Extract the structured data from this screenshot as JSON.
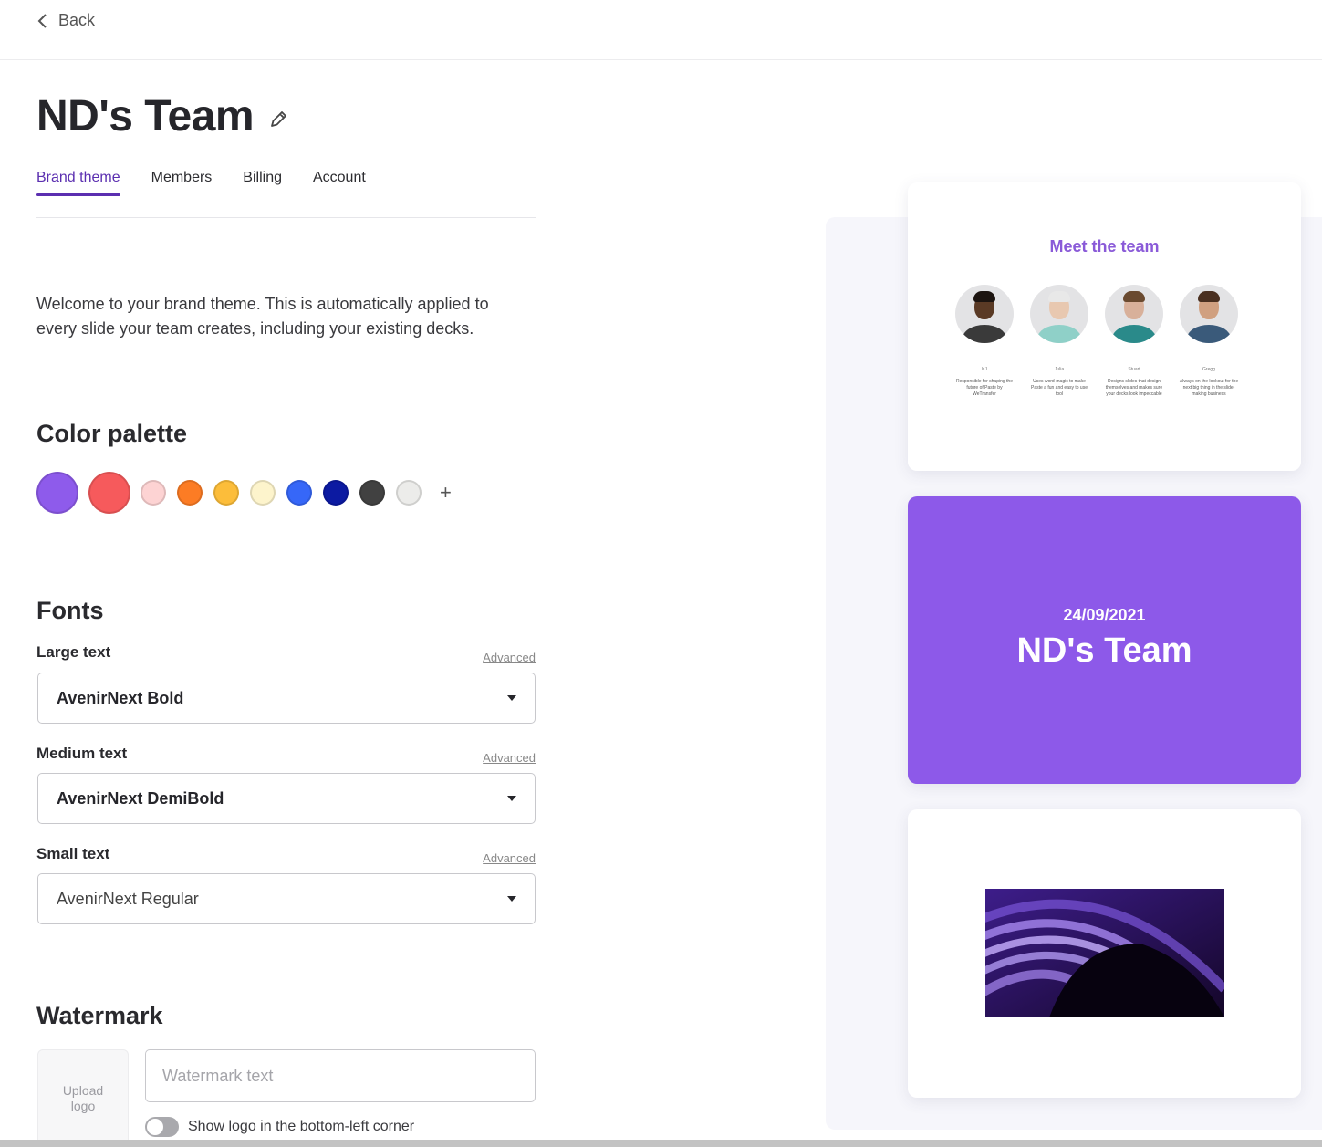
{
  "nav": {
    "back_label": "Back"
  },
  "header": {
    "title": "ND's Team"
  },
  "tabs": [
    {
      "label": "Brand theme",
      "active": true
    },
    {
      "label": "Members",
      "active": false
    },
    {
      "label": "Billing",
      "active": false
    },
    {
      "label": "Account",
      "active": false
    }
  ],
  "intro": "Welcome to your brand theme. This is automatically applied to every slide your team creates, including your existing decks.",
  "palette": {
    "heading": "Color palette",
    "colors": [
      "#8e5beb",
      "#f65a5c",
      "#fdd3d3",
      "#fc7c24",
      "#fcbd3a",
      "#fdf4cc",
      "#3667f8",
      "#0c1aa2",
      "#414141",
      "#ececea"
    ],
    "add_label": "+"
  },
  "fonts": {
    "heading": "Fonts",
    "advanced_label": "Advanced",
    "large": {
      "label": "Large text",
      "value": "AvenirNext Bold"
    },
    "medium": {
      "label": "Medium text",
      "value": "AvenirNext DemiBold"
    },
    "small": {
      "label": "Small text",
      "value": "AvenirNext Regular"
    }
  },
  "watermark": {
    "heading": "Watermark",
    "upload_label": "Upload logo",
    "text_placeholder": "Watermark text",
    "text_value": "",
    "toggle_label": "Show logo in the bottom-left corner",
    "toggle_on": false
  },
  "preview": {
    "team_slide": {
      "title": "Meet the team",
      "members": [
        {
          "name": "KJ",
          "desc": "Responsible for shaping the future of Paste by WeTransfer"
        },
        {
          "name": "Julia",
          "desc": "Uses word-magic to make Paste a fun and easy to use tool"
        },
        {
          "name": "Stuart",
          "desc": "Designs slides that design themselves and makes sure your decks look impeccable"
        },
        {
          "name": "Gregg",
          "desc": "Always on the lookout for the next big thing in the slide-making business"
        }
      ]
    },
    "title_slide": {
      "date": "24/09/2021",
      "title": "ND's Team",
      "bg_color": "#8d59e9"
    },
    "image_slide": {
      "image": "abstract-purple-arcs"
    }
  }
}
